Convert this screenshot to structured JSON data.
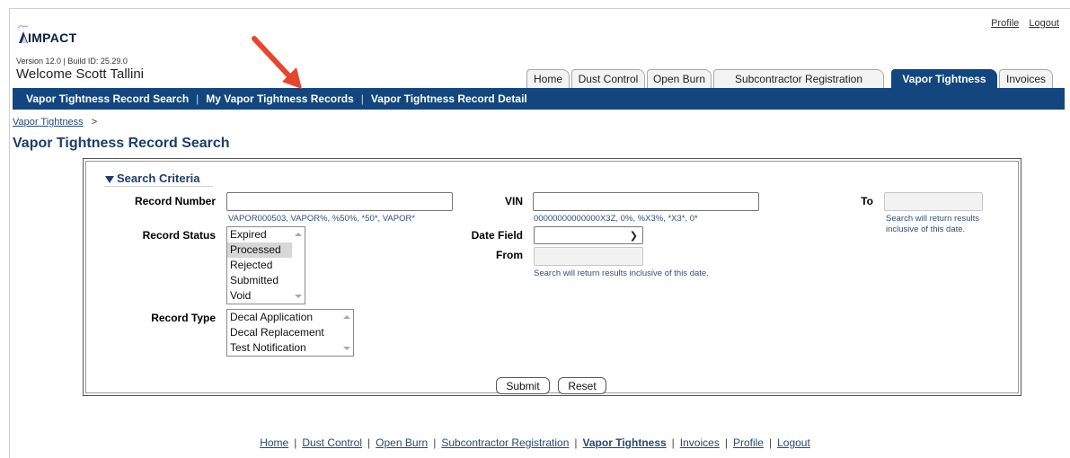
{
  "header": {
    "logo_text": "IMPACT",
    "version": "Version 12.0 | Build ID: 25.29.0",
    "welcome": "Welcome Scott Tallini",
    "top_links": [
      "Profile",
      "Logout"
    ]
  },
  "tabs": [
    "Home",
    "Dust Control",
    "Open Burn",
    "Subcontractor Registration",
    "Vapor Tightness",
    "Invoices"
  ],
  "subnav": {
    "items": [
      "Vapor Tightness Record Search",
      "My Vapor Tightness Records",
      "Vapor Tightness Record Detail"
    ],
    "separator": "|"
  },
  "breadcrumb": {
    "link": "Vapor Tightness",
    "sep": ">"
  },
  "page_title": "Vapor Tightness Record Search",
  "search": {
    "heading": "Search Criteria",
    "record_number": {
      "label": "Record Number",
      "value": "",
      "hint": "VAPOR000503, VAPOR%, %50%, *50*, VAPOR*"
    },
    "vin": {
      "label": "VIN",
      "value": "",
      "hint": "00000000000000X3Z, 0%, %X3%, *X3*, 0*"
    },
    "to": {
      "label": "To",
      "value": "",
      "hint_line1": "Search will return results",
      "hint_line2": "inclusive of this date."
    },
    "record_status": {
      "label": "Record Status",
      "options": [
        "Expired",
        "Processed",
        "Rejected",
        "Submitted",
        "Void"
      ],
      "selected": "Processed"
    },
    "date_field": {
      "label": "Date Field",
      "value": ""
    },
    "from": {
      "label": "From",
      "value": "",
      "hint": "Search will return results inclusive of this date."
    },
    "record_type": {
      "label": "Record Type",
      "options": [
        "Decal Application",
        "Decal Replacement",
        "Test Notification"
      ]
    },
    "submit_label": "Submit",
    "reset_label": "Reset"
  },
  "footer": {
    "links": [
      "Home",
      "Dust Control",
      "Open Burn",
      "Subcontractor Registration",
      "Vapor Tightness",
      "Invoices",
      "Profile",
      "Logout"
    ],
    "separator": "|"
  },
  "colors": {
    "nav_blue": "#13467f",
    "title_blue": "#1d3e69",
    "arrow_red": "#e8452f"
  }
}
